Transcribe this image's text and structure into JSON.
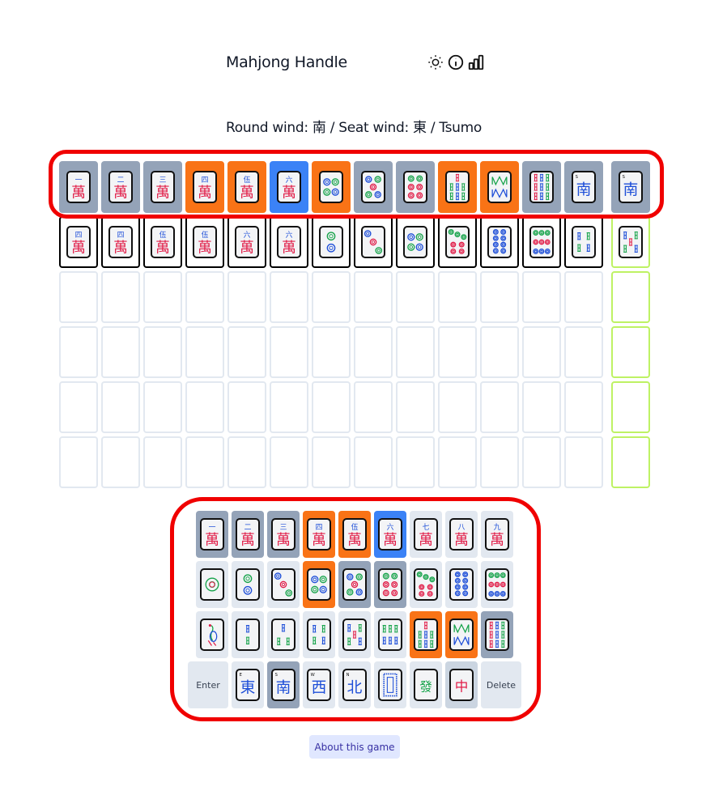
{
  "header": {
    "title": "Mahjong Handle",
    "icons": [
      "sun-icon",
      "info-icon",
      "chart-bar-icon"
    ]
  },
  "wind_line": "Round wind: 南 / Seat wind: 東 / Tsumo",
  "colors": {
    "absent": "#94a3b8",
    "present": "#f97316",
    "correct": "#3b82f6",
    "empty_border": "#e2e8f0",
    "hint_border": "#bef264",
    "highlight": "#f00000",
    "key_default": "#e2e8f0"
  },
  "board": {
    "rows": [
      {
        "tiles": [
          "1m",
          "2m",
          "3m",
          "4m",
          "5m",
          "6m",
          "4p",
          "5p",
          "6p",
          "7s",
          "8s",
          "9s",
          "S",
          "S"
        ],
        "states": [
          "absent",
          "absent",
          "absent",
          "present",
          "present",
          "correct",
          "present",
          "absent",
          "absent",
          "present",
          "present",
          "absent",
          "absent",
          "absent"
        ]
      },
      {
        "tiles": [
          "4m",
          "4m",
          "5m",
          "5m",
          "6m",
          "6m",
          "2p",
          "3p",
          "4p",
          "7p",
          "8p",
          "9p",
          "4s",
          "5s"
        ],
        "states": [
          "typed",
          "typed",
          "typed",
          "typed",
          "typed",
          "typed",
          "typed",
          "typed",
          "typed",
          "typed",
          "typed",
          "typed",
          "typed",
          "typed"
        ]
      },
      {
        "tiles": [],
        "states": []
      },
      {
        "tiles": [],
        "states": []
      },
      {
        "tiles": [],
        "states": []
      },
      {
        "tiles": [],
        "states": []
      }
    ]
  },
  "keyboard": {
    "rows": [
      [
        {
          "tile": "1m",
          "state": "absent"
        },
        {
          "tile": "2m",
          "state": "absent"
        },
        {
          "tile": "3m",
          "state": "absent"
        },
        {
          "tile": "4m",
          "state": "present"
        },
        {
          "tile": "5m",
          "state": "present"
        },
        {
          "tile": "6m",
          "state": "correct"
        },
        {
          "tile": "7m",
          "state": "default"
        },
        {
          "tile": "8m",
          "state": "default"
        },
        {
          "tile": "9m",
          "state": "default"
        }
      ],
      [
        {
          "tile": "1p",
          "state": "default"
        },
        {
          "tile": "2p",
          "state": "default"
        },
        {
          "tile": "3p",
          "state": "default"
        },
        {
          "tile": "4p",
          "state": "present"
        },
        {
          "tile": "5p",
          "state": "absent"
        },
        {
          "tile": "6p",
          "state": "absent"
        },
        {
          "tile": "7p",
          "state": "default"
        },
        {
          "tile": "8p",
          "state": "default"
        },
        {
          "tile": "9p",
          "state": "default"
        }
      ],
      [
        {
          "tile": "1s",
          "state": "default"
        },
        {
          "tile": "2s",
          "state": "default"
        },
        {
          "tile": "3s",
          "state": "default"
        },
        {
          "tile": "4s",
          "state": "default"
        },
        {
          "tile": "5s",
          "state": "default"
        },
        {
          "tile": "6s",
          "state": "default"
        },
        {
          "tile": "7s",
          "state": "present"
        },
        {
          "tile": "8s",
          "state": "present"
        },
        {
          "tile": "9s",
          "state": "absent"
        }
      ],
      [
        {
          "label": "Enter",
          "action": "enter"
        },
        {
          "tile": "E",
          "state": "default"
        },
        {
          "tile": "S",
          "state": "absent"
        },
        {
          "tile": "W",
          "state": "default"
        },
        {
          "tile": "N",
          "state": "default"
        },
        {
          "tile": "P",
          "state": "default"
        },
        {
          "tile": "F",
          "state": "default"
        },
        {
          "tile": "C",
          "state": "pressed"
        },
        {
          "label": "Delete",
          "action": "delete"
        }
      ]
    ]
  },
  "about_button": "About this game",
  "tile_glyphs": {
    "man_numerals": [
      "一",
      "二",
      "三",
      "四",
      "伍",
      "六",
      "七",
      "八",
      "九"
    ],
    "man_char": "萬",
    "winds": {
      "E": {
        "char": "東",
        "letter": "E"
      },
      "S": {
        "char": "南",
        "letter": "S"
      },
      "W": {
        "char": "西",
        "letter": "W"
      },
      "N": {
        "char": "北",
        "letter": "N"
      }
    },
    "dragons": {
      "F": "發",
      "C": "中"
    }
  }
}
